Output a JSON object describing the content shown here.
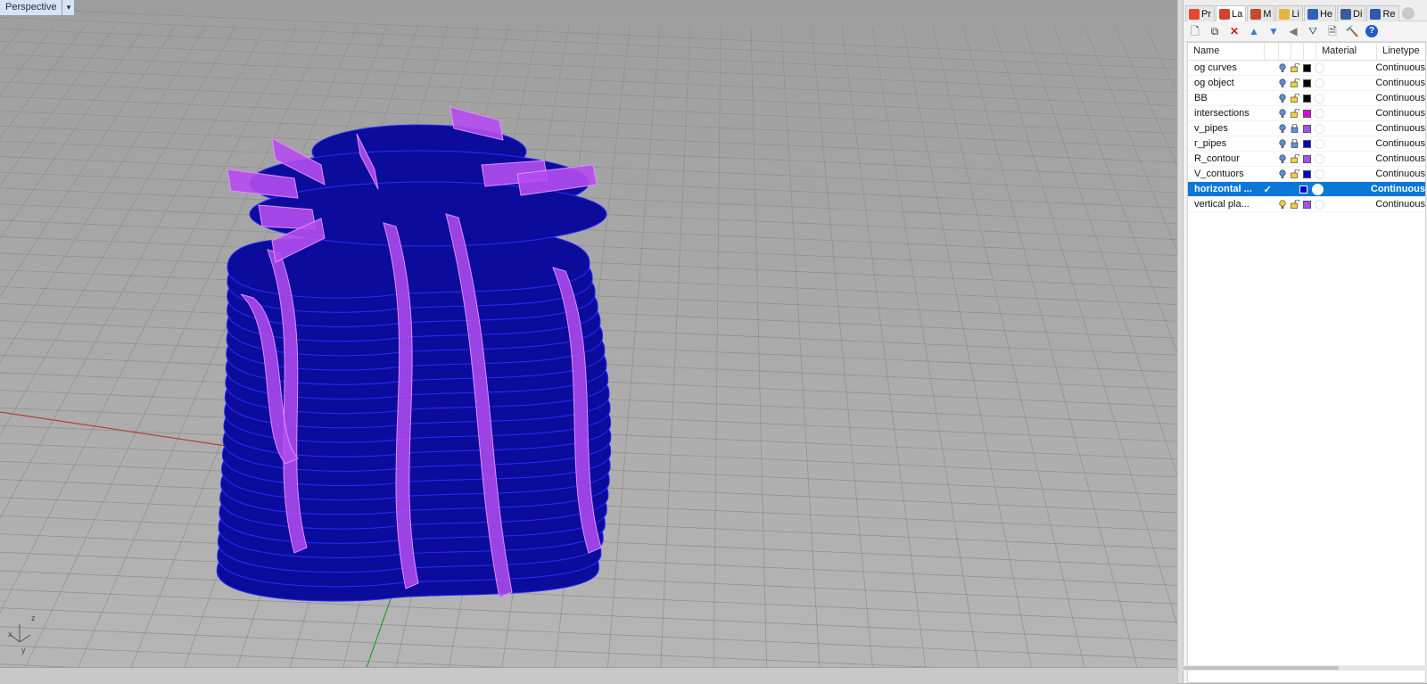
{
  "viewport": {
    "title": "Perspective",
    "axes": {
      "z": "z",
      "x": "x",
      "y": "y"
    }
  },
  "panel": {
    "tabs": [
      {
        "label": "Pr",
        "icon": "properties-icon",
        "color": "#e3482e"
      },
      {
        "label": "La",
        "icon": "layers-icon",
        "color": "#d6402a"
      },
      {
        "label": "M",
        "icon": "materials-icon",
        "color": "#c44b2a"
      },
      {
        "label": "Li",
        "icon": "libraries-icon",
        "color": "#e5b43a"
      },
      {
        "label": "He",
        "icon": "help-icon",
        "color": "#2f62b6"
      },
      {
        "label": "Di",
        "icon": "display-icon",
        "color": "#3a5aa0"
      },
      {
        "label": "Re",
        "icon": "rendering-icon",
        "color": "#2b58b0"
      }
    ],
    "active_tab": "La",
    "toolbar": [
      "new-layer-icon",
      "new-sublayer-icon",
      "delete-icon",
      "move-up-icon",
      "move-down-icon",
      "move-left-icon",
      "filter-icon",
      "tools-icon",
      "build-icon",
      "help-icon"
    ],
    "columns": {
      "name": "Name",
      "material": "Material",
      "linetype": "Linetype"
    },
    "layers": [
      {
        "name": "og curves",
        "current": false,
        "visible": true,
        "locked": false,
        "color": "#000000",
        "linetype": "Continuous"
      },
      {
        "name": "og object",
        "current": false,
        "visible": true,
        "locked": false,
        "color": "#000000",
        "linetype": "Continuous"
      },
      {
        "name": "BB",
        "current": false,
        "visible": true,
        "locked": false,
        "color": "#000000",
        "linetype": "Continuous"
      },
      {
        "name": "intersections",
        "current": false,
        "visible": true,
        "locked": false,
        "color": "#e000e0",
        "linetype": "Continuous"
      },
      {
        "name": "v_pipes",
        "current": false,
        "visible": true,
        "locked": true,
        "color": "#a64dff",
        "linetype": "Continuous"
      },
      {
        "name": "r_pipes",
        "current": false,
        "visible": true,
        "locked": true,
        "color": "#0000c8",
        "linetype": "Continuous"
      },
      {
        "name": "R_contour",
        "current": false,
        "visible": true,
        "locked": false,
        "color": "#a64dff",
        "linetype": "Continuous"
      },
      {
        "name": "V_contuors",
        "current": false,
        "visible": true,
        "locked": false,
        "color": "#0000c8",
        "linetype": "Continuous"
      },
      {
        "name": "horizontal ...",
        "current": true,
        "visible": true,
        "locked": false,
        "color": "#0000c8",
        "linetype": "Continuous"
      },
      {
        "name": "vertical pla...",
        "current": false,
        "visible": false,
        "locked": false,
        "color": "#a64dff",
        "linetype": "Continuous"
      }
    ]
  },
  "colors": {
    "selection": "#0a78d6",
    "viewport_bg": "#a9a9a9",
    "grid": "#9c9c9c",
    "slab_blue": "#0c0c9c",
    "fin_purple": "#b44cf0"
  }
}
